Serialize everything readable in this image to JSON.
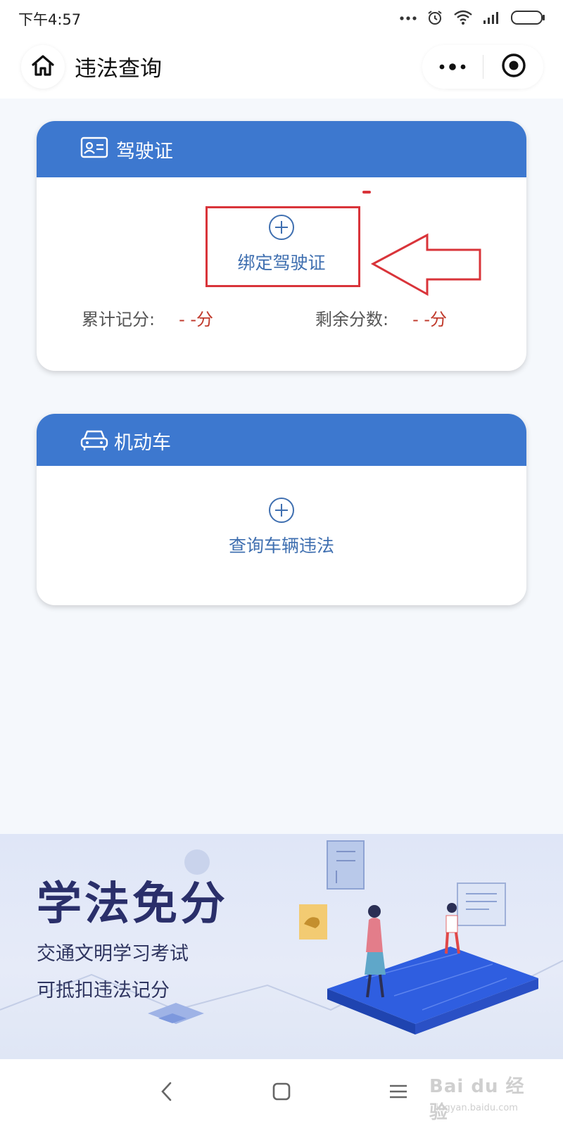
{
  "status_bar": {
    "time": "下午4:57",
    "icons": [
      "more-dots-icon",
      "alarm-icon",
      "wifi-icon",
      "signal-icon",
      "battery-icon"
    ]
  },
  "title_bar": {
    "title": "违法查询",
    "icons": [
      "home-icon",
      "more-icon",
      "close-target-icon"
    ]
  },
  "license_card": {
    "title": "驾驶证",
    "header_color": "#3d78cf",
    "action_label": "绑定驾驶证",
    "points_total_label": "累计记分:",
    "points_total_value": "- -分",
    "points_remaining_label": "剩余分数:",
    "points_remaining_value": "- -分"
  },
  "vehicle_card": {
    "title": "机动车",
    "action_label": "查询车辆违法"
  },
  "annotation": {
    "color": "#d9343a"
  },
  "banner": {
    "title": "学法免分",
    "line1": "交通文明学习考试",
    "line2": "可抵扣违法记分"
  },
  "nav_bar": {
    "icons": [
      "back-icon",
      "home-square-icon",
      "menu-icon"
    ]
  },
  "watermark": {
    "text": "Bai du 经验",
    "sub": "jingyan.baidu.com"
  }
}
